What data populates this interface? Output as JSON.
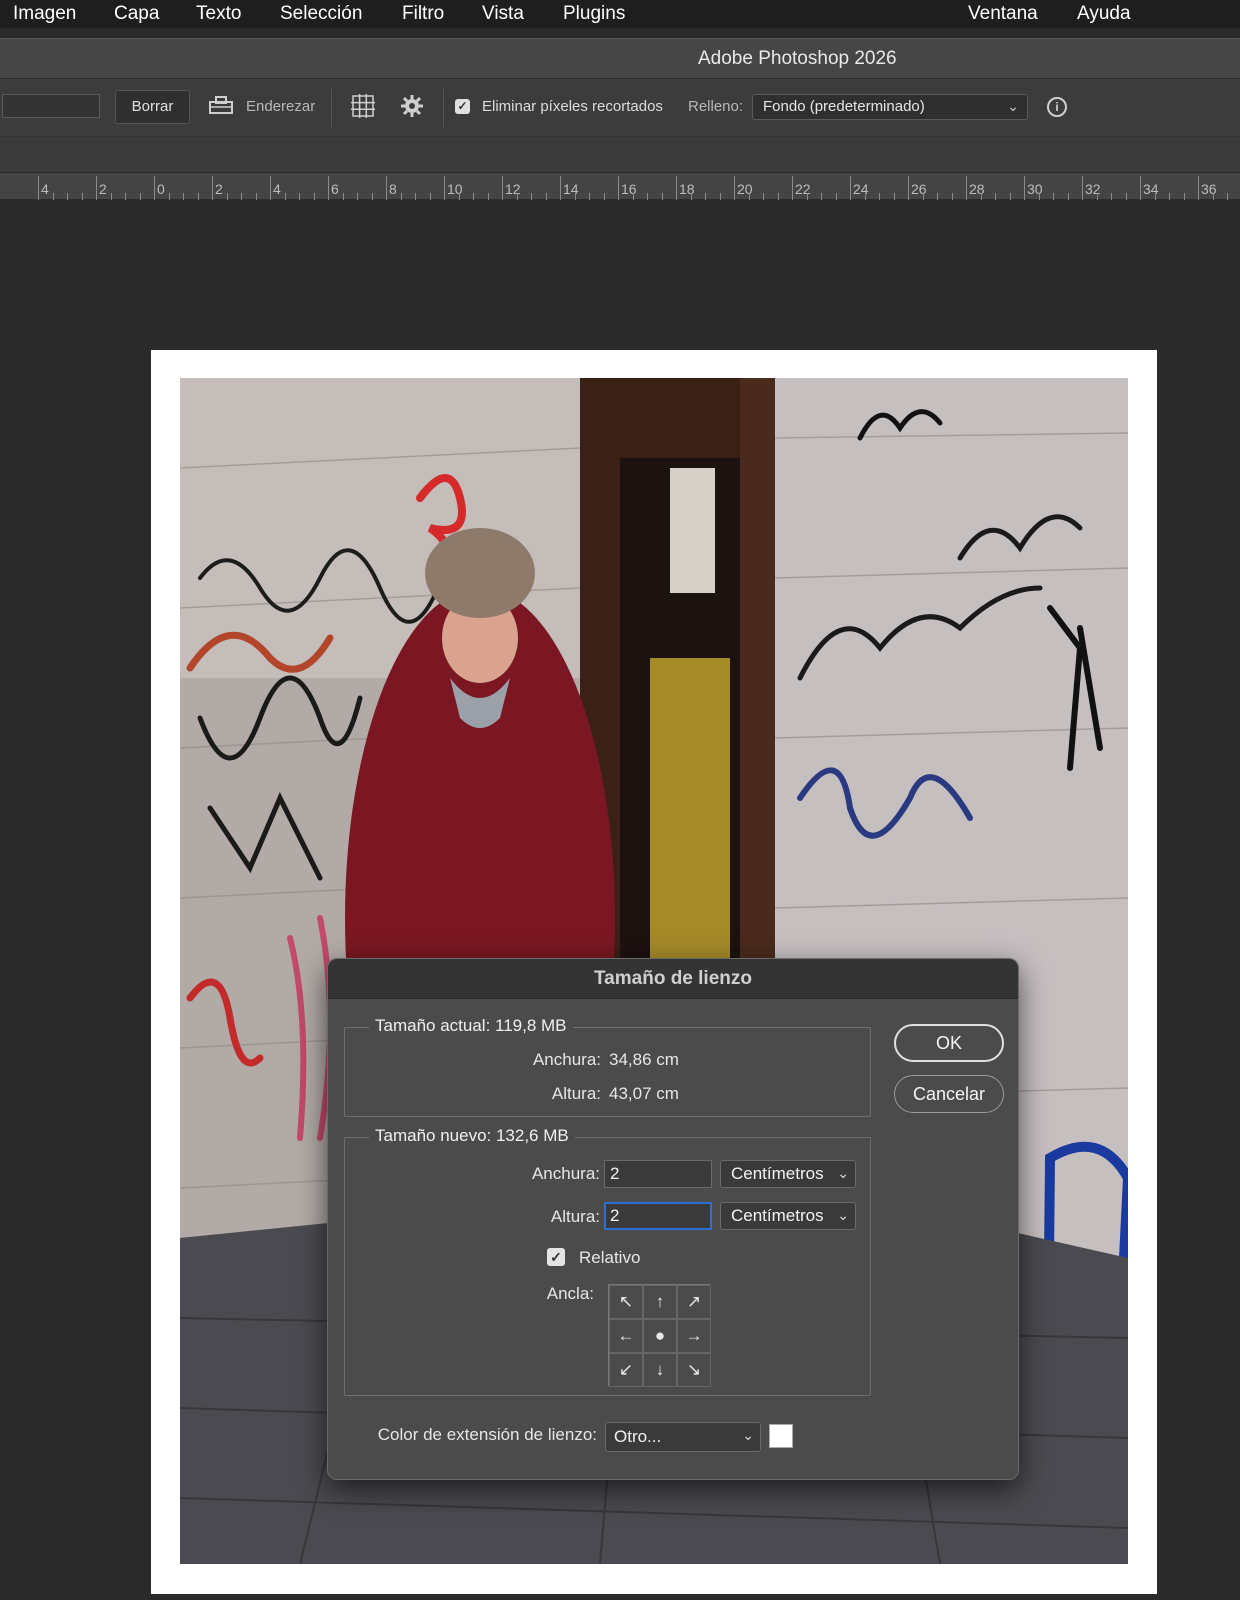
{
  "menu": [
    "Imagen",
    "Capa",
    "Texto",
    "Selección",
    "Filtro",
    "Vista",
    "Plugins",
    "Ventana",
    "Ayuda"
  ],
  "window_title": "Adobe Photoshop 2026",
  "options": {
    "clear_label": "Borrar",
    "straighten_label": "Enderezar",
    "delete_cropped_label": "Eliminar píxeles recortados",
    "delete_cropped_checked": true,
    "fill_label": "Relleno:",
    "fill_value": "Fondo (predeterminado)"
  },
  "ruler_labels": [
    "4",
    "2",
    "0",
    "2",
    "4",
    "6",
    "8",
    "10",
    "12",
    "14",
    "16",
    "18",
    "20",
    "22",
    "24",
    "26",
    "28",
    "30",
    "32",
    "34",
    "36"
  ],
  "dialog": {
    "title": "Tamaño de lienzo",
    "current": {
      "legend": "Tamaño actual: 119,8 MB",
      "width_label": "Anchura:",
      "width_value": "34,86 cm",
      "height_label": "Altura:",
      "height_value": "43,07 cm"
    },
    "new": {
      "legend": "Tamaño nuevo: 132,6 MB",
      "width_label": "Anchura:",
      "width_value": "2",
      "width_unit": "Centímetros",
      "height_label": "Altura:",
      "height_value": "2",
      "height_unit": "Centímetros",
      "relative_label": "Relativo",
      "relative_checked": true,
      "anchor_label": "Ancla:",
      "anchor_selected": "center"
    },
    "ok_label": "OK",
    "cancel_label": "Cancelar",
    "extension_color_label": "Color de extensión de lienzo:",
    "extension_color_value": "Otro...",
    "extension_color_swatch": "#ffffff"
  },
  "icons": {
    "straighten": "level-icon",
    "grid_overlay": "grid-icon",
    "settings": "gear-icon",
    "info": "info-icon",
    "anchor_arrows": [
      "arrow-up-left",
      "arrow-up",
      "arrow-up-right",
      "arrow-left",
      "center-dot",
      "arrow-right",
      "arrow-down-left",
      "arrow-down",
      "arrow-down-right"
    ]
  }
}
